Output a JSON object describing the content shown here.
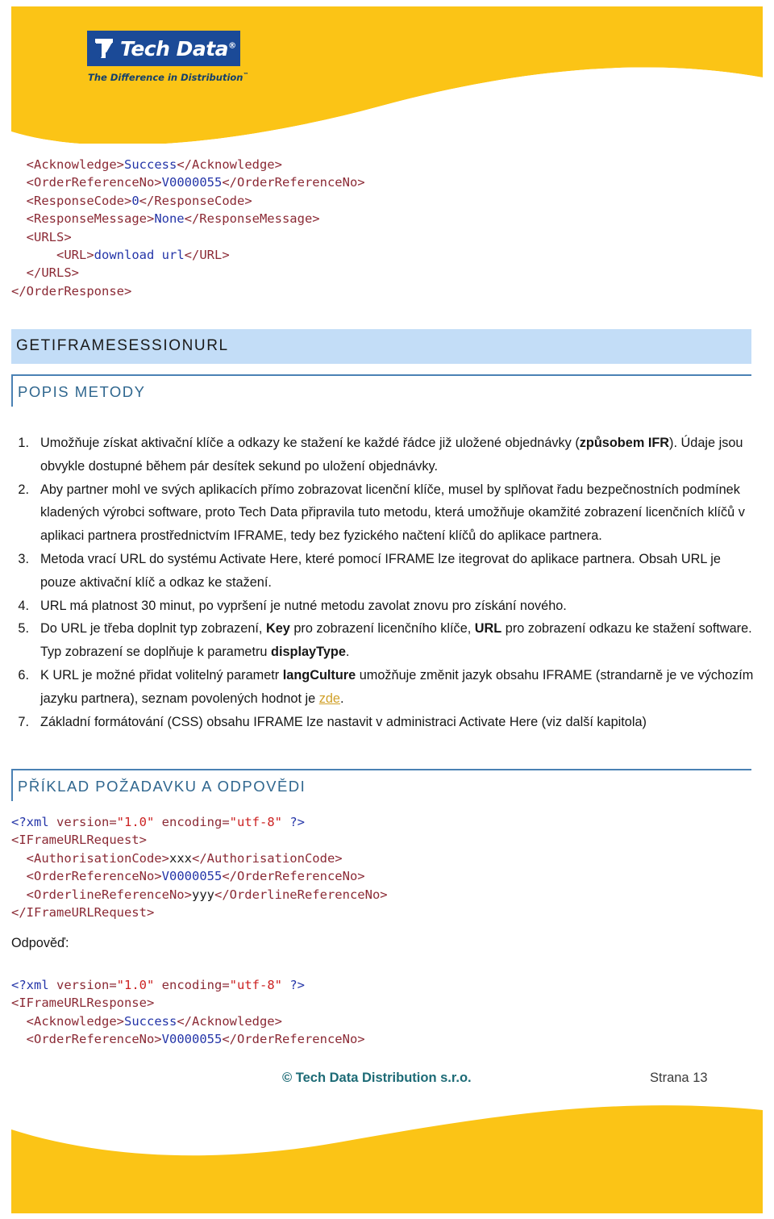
{
  "brand": {
    "logo_name": "Tech Data",
    "logo_registered": "®",
    "tagline": "The Difference in Distribution",
    "tagline_tm": "™",
    "yellow": "#fbc416",
    "logo_blue": "#1b4a97",
    "tagline_blue": "#14406b"
  },
  "code_top": [
    {
      "indent": 2,
      "parts": [
        {
          "t": "tag",
          "s": "<Acknowledge>"
        },
        {
          "t": "val",
          "s": "Success"
        },
        {
          "t": "tag",
          "s": "</Acknowledge>"
        }
      ]
    },
    {
      "indent": 2,
      "parts": [
        {
          "t": "tag",
          "s": "<OrderReferenceNo>"
        },
        {
          "t": "val",
          "s": "V0000055"
        },
        {
          "t": "tag",
          "s": "</OrderReferenceNo>"
        }
      ]
    },
    {
      "indent": 2,
      "parts": [
        {
          "t": "tag",
          "s": "<ResponseCode>"
        },
        {
          "t": "val",
          "s": "0"
        },
        {
          "t": "tag",
          "s": "</ResponseCode>"
        }
      ]
    },
    {
      "indent": 2,
      "parts": [
        {
          "t": "tag",
          "s": "<ResponseMessage>"
        },
        {
          "t": "val",
          "s": "None"
        },
        {
          "t": "tag",
          "s": "</ResponseMessage>"
        }
      ]
    },
    {
      "indent": 2,
      "parts": [
        {
          "t": "tag",
          "s": "<URLS>"
        }
      ]
    },
    {
      "indent": 6,
      "parts": [
        {
          "t": "tag",
          "s": "<URL>"
        },
        {
          "t": "val",
          "s": "download url"
        },
        {
          "t": "tag",
          "s": "</URL>"
        }
      ]
    },
    {
      "indent": 2,
      "parts": [
        {
          "t": "tag",
          "s": "</URLS>"
        }
      ]
    },
    {
      "indent": 0,
      "parts": [
        {
          "t": "tag",
          "s": "</OrderResponse>"
        }
      ]
    }
  ],
  "headings": {
    "getiframesessionurl": "GETIFRAMESESSIONURL",
    "popis_metody": "POPIS METODY",
    "priklad": "PŘÍKLAD POŽADAVKU A ODPOVĚDI",
    "band_color": "#c3ddf7",
    "rule_color": "#4a81b4",
    "rule_text_color": "#30678f"
  },
  "list": [
    {
      "num": "1.",
      "segments": [
        {
          "t": "n",
          "s": "Umožňuje získat aktivační klíče a odkazy ke stažení ke každé řádce již uložené objednávky ("
        },
        {
          "t": "b",
          "s": "způsobem IFR"
        },
        {
          "t": "n",
          "s": "). Údaje jsou obvykle dostupné během pár desítek sekund po uložení objednávky."
        }
      ]
    },
    {
      "num": "2.",
      "segments": [
        {
          "t": "n",
          "s": "Aby partner mohl ve svých aplikacích přímo zobrazovat licenční klíče, musel by splňovat řadu bezpečnostních podmínek kladených výrobci software, proto Tech Data připravila tuto metodu, která umožňuje okamžité zobrazení licenčních klíčů v aplikaci partnera prostřednictvím IFRAME, tedy bez fyzického načtení klíčů do aplikace partnera."
        }
      ]
    },
    {
      "num": "3.",
      "segments": [
        {
          "t": "n",
          "s": "Metoda vrací URL do systému Activate Here, které pomocí IFRAME lze itegrovat do aplikace partnera. Obsah URL je pouze aktivační klíč a odkaz ke stažení."
        }
      ]
    },
    {
      "num": "4.",
      "segments": [
        {
          "t": "n",
          "s": "URL má platnost 30 minut, po vypršení je nutné metodu zavolat znovu pro získání nového."
        }
      ]
    },
    {
      "num": "5.",
      "segments": [
        {
          "t": "n",
          "s": "Do URL je třeba doplnit typ zobrazení, "
        },
        {
          "t": "b",
          "s": "Key"
        },
        {
          "t": "n",
          "s": " pro zobrazení licenčního klíče, "
        },
        {
          "t": "b",
          "s": "URL"
        },
        {
          "t": "n",
          "s": " pro zobrazení odkazu ke stažení software. Typ zobrazení se doplňuje k parametru "
        },
        {
          "t": "b",
          "s": "displayType"
        },
        {
          "t": "n",
          "s": "."
        }
      ]
    },
    {
      "num": "6.",
      "segments": [
        {
          "t": "n",
          "s": "K URL je možné přidat volitelný parametr "
        },
        {
          "t": "b",
          "s": "langCulture"
        },
        {
          "t": "n",
          "s": " umožňuje změnit jazyk obsahu IFRAME (strandarně je ve výchozím jazyku partnera), seznam povolených hodnot je "
        },
        {
          "t": "link",
          "s": "zde"
        },
        {
          "t": "n",
          "s": "."
        }
      ]
    },
    {
      "num": "7.",
      "segments": [
        {
          "t": "n",
          "s": "Základní formátování (CSS) obsahu IFRAME lze nastavit v administraci Activate Here (viz další kapitola)"
        }
      ]
    }
  ],
  "code_request": [
    {
      "indent": 0,
      "parts": [
        {
          "t": "pi",
          "s": "<?xml "
        },
        {
          "t": "attr",
          "s": "version="
        },
        {
          "t": "str",
          "s": "\"1.0\""
        },
        {
          "t": "plain",
          "s": " "
        },
        {
          "t": "attr",
          "s": "encoding="
        },
        {
          "t": "str",
          "s": "\"utf-8\""
        },
        {
          "t": "pi",
          "s": " ?>"
        }
      ]
    },
    {
      "indent": 0,
      "parts": [
        {
          "t": "tag",
          "s": "<IFrameURLRequest>"
        }
      ]
    },
    {
      "indent": 2,
      "parts": [
        {
          "t": "tag",
          "s": "<AuthorisationCode>"
        },
        {
          "t": "plain",
          "s": "xxx"
        },
        {
          "t": "tag",
          "s": "</AuthorisationCode>"
        }
      ]
    },
    {
      "indent": 2,
      "parts": [
        {
          "t": "tag",
          "s": "<OrderReferenceNo>"
        },
        {
          "t": "val",
          "s": "V0000055"
        },
        {
          "t": "tag",
          "s": "</OrderReferenceNo>"
        }
      ]
    },
    {
      "indent": 2,
      "parts": [
        {
          "t": "tag",
          "s": "<OrderlineReferenceNo>"
        },
        {
          "t": "plain",
          "s": "yyy"
        },
        {
          "t": "tag",
          "s": "</OrderlineReferenceNo>"
        }
      ]
    },
    {
      "indent": 0,
      "parts": [
        {
          "t": "tag",
          "s": "</IFrameURLRequest>"
        }
      ]
    }
  ],
  "odpoved_label": "Odpověď:",
  "code_response": [
    {
      "indent": 0,
      "parts": [
        {
          "t": "pi",
          "s": "<?xml "
        },
        {
          "t": "attr",
          "s": "version="
        },
        {
          "t": "str",
          "s": "\"1.0\""
        },
        {
          "t": "plain",
          "s": " "
        },
        {
          "t": "attr",
          "s": "encoding="
        },
        {
          "t": "str",
          "s": "\"utf-8\""
        },
        {
          "t": "pi",
          "s": " ?>"
        }
      ]
    },
    {
      "indent": 0,
      "parts": [
        {
          "t": "tag",
          "s": "<IFrameURLResponse>"
        }
      ]
    },
    {
      "indent": 2,
      "parts": [
        {
          "t": "tag",
          "s": "<Acknowledge>"
        },
        {
          "t": "val",
          "s": "Success"
        },
        {
          "t": "tag",
          "s": "</Acknowledge>"
        }
      ]
    },
    {
      "indent": 2,
      "parts": [
        {
          "t": "tag",
          "s": "<OrderReferenceNo>"
        },
        {
          "t": "val",
          "s": "V0000055"
        },
        {
          "t": "tag",
          "s": "</OrderReferenceNo>"
        }
      ]
    }
  ],
  "footer": {
    "copyright": "© Tech Data Distribution s.r.o.",
    "page_label": "Strana 13",
    "copyright_color": "#1d6b76"
  }
}
